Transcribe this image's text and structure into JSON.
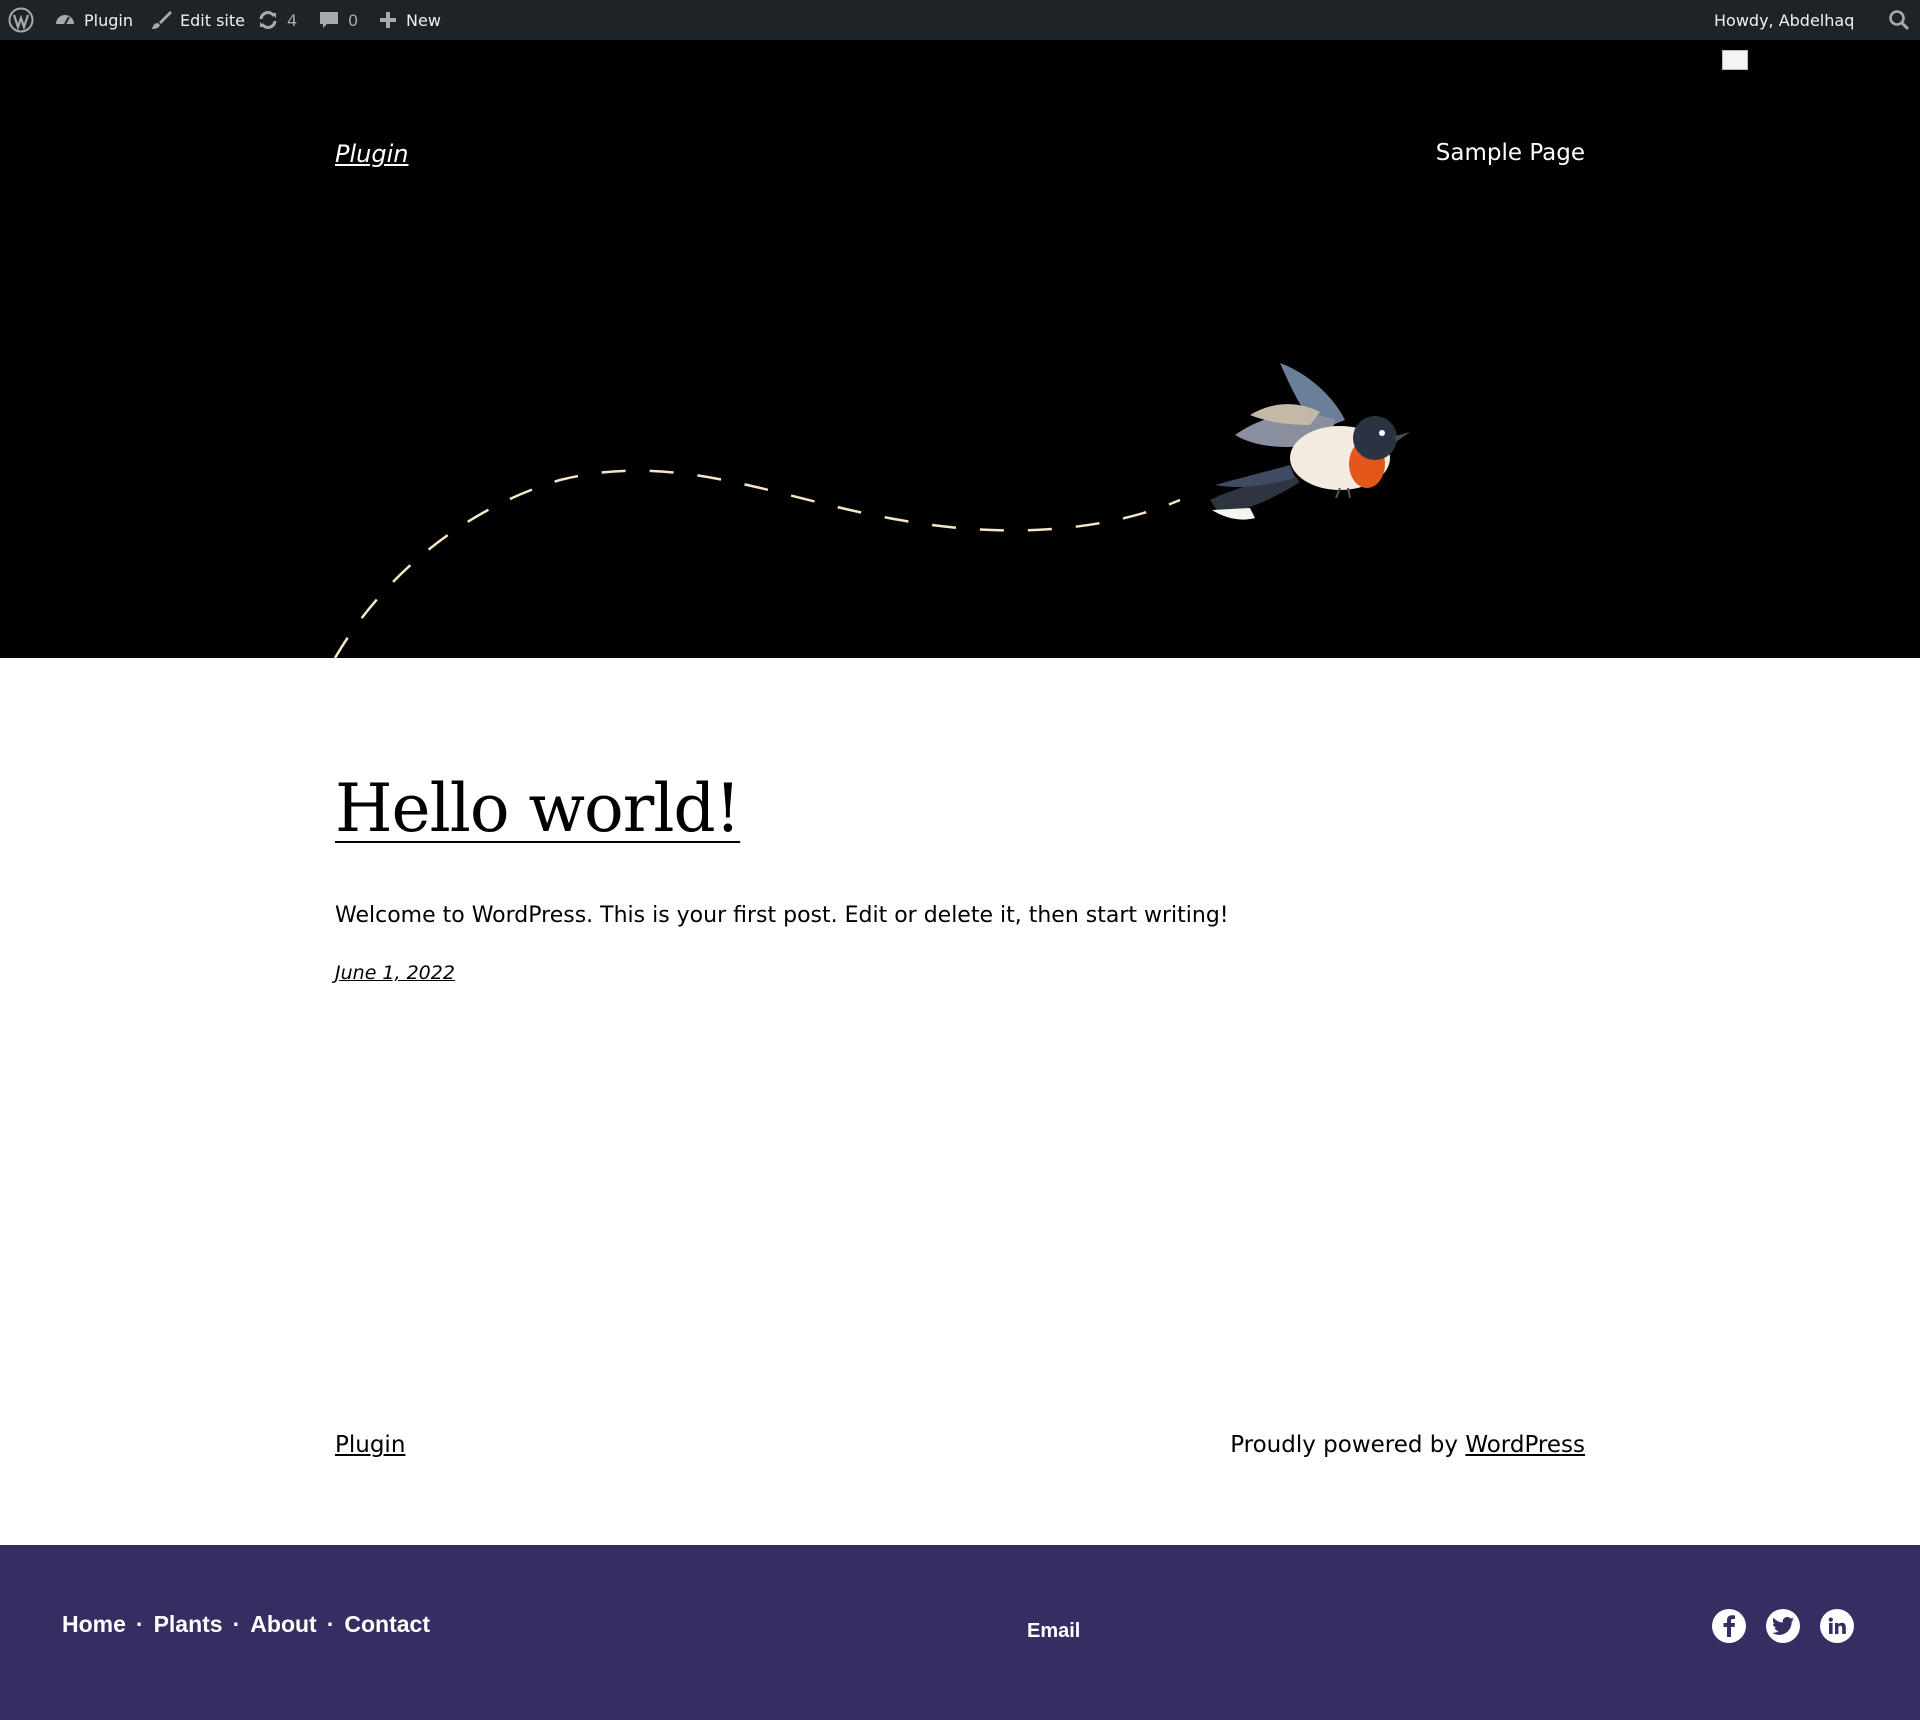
{
  "adminbar": {
    "site_name": "Plugin",
    "edit_site": "Edit site",
    "updates_count": "4",
    "comments_count": "0",
    "new_label": "New",
    "howdy": "Howdy, Abdelhaq"
  },
  "header": {
    "site_title": "Plugin",
    "nav": [
      "Sample Page"
    ]
  },
  "post": {
    "title": "Hello world!",
    "excerpt": "Welcome to WordPress. This is your first post. Edit or delete it, then start writing!",
    "date": "June 1, 2022"
  },
  "footer": {
    "site_title": "Plugin",
    "powered_prefix": "Proudly powered by ",
    "powered_link": "WordPress"
  },
  "bottombar": {
    "nav": [
      "Home",
      "Plants",
      "About",
      "Contact"
    ],
    "separator": "·",
    "email_label": "Email",
    "social": [
      "facebook-icon",
      "twitter-icon",
      "linkedin-icon"
    ],
    "background": "#382d62"
  },
  "colors": {
    "adminbar_bg": "#1d2327",
    "hero_bg": "#000000",
    "dashed_line": "#f5e6c8"
  }
}
